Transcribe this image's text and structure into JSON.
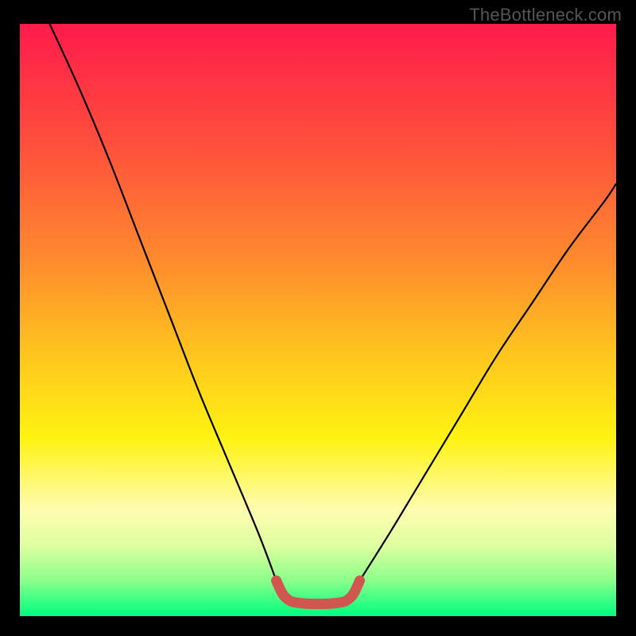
{
  "watermark": "TheBottleneck.com",
  "chart_data": {
    "type": "line",
    "title": "",
    "xlabel": "",
    "ylabel": "",
    "xlim": [
      0,
      100
    ],
    "ylim": [
      0,
      100
    ],
    "grid": false,
    "legend": false,
    "background_gradient": {
      "stops": [
        {
          "offset": 0.0,
          "color": "#ff1b4b"
        },
        {
          "offset": 0.2,
          "color": "#ff4e3d"
        },
        {
          "offset": 0.4,
          "color": "#ff8b2e"
        },
        {
          "offset": 0.55,
          "color": "#ffc21f"
        },
        {
          "offset": 0.7,
          "color": "#fff312"
        },
        {
          "offset": 0.82,
          "color": "#fffcb0"
        },
        {
          "offset": 0.88,
          "color": "#e0ffa0"
        },
        {
          "offset": 0.94,
          "color": "#8bff8b"
        },
        {
          "offset": 0.98,
          "color": "#2cff83"
        },
        {
          "offset": 1.0,
          "color": "#00ff80"
        }
      ]
    },
    "series": [
      {
        "name": "bottleneck-curve-left",
        "stroke": "#000000",
        "stroke_width": 2.2,
        "x": [
          5,
          10,
          15,
          20,
          25,
          30,
          35,
          40,
          43
        ],
        "y": [
          100,
          89,
          77,
          64,
          51,
          38,
          26,
          14,
          6
        ]
      },
      {
        "name": "bottleneck-curve-right",
        "stroke": "#000000",
        "stroke_width": 2.2,
        "x": [
          57,
          62,
          68,
          74,
          80,
          86,
          92,
          98,
          100
        ],
        "y": [
          6,
          14,
          24,
          34,
          44,
          53,
          62,
          70,
          73
        ]
      },
      {
        "name": "optimal-zone",
        "stroke": "#d0574f",
        "stroke_width": 13,
        "linecap": "round",
        "x": [
          43,
          44.5,
          47,
          53,
          55.5,
          57
        ],
        "y": [
          6,
          3.2,
          2.2,
          2.2,
          3.2,
          6
        ]
      }
    ],
    "annotations": []
  }
}
